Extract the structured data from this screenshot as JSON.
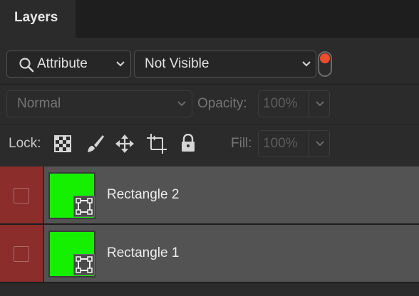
{
  "panel": {
    "tab_label": "Layers"
  },
  "filter": {
    "kind_label": "Attribute",
    "value_label": "Not Visible",
    "toggle_color": "#ea4e2c"
  },
  "blend": {
    "mode_label": "Normal",
    "opacity_label": "Opacity:",
    "opacity_value": "100%"
  },
  "lock": {
    "label": "Lock:",
    "icons": [
      "transparent-pixels-lock-icon",
      "brush-lock-icon",
      "move-lock-icon",
      "artboard-lock-icon",
      "padlock-icon"
    ],
    "fill_label": "Fill:",
    "fill_value": "100%"
  },
  "layers": [
    {
      "name": "Rectangle 2",
      "thumb_color": "#14f000",
      "visible": false
    },
    {
      "name": "Rectangle 1",
      "thumb_color": "#14f000",
      "visible": false
    }
  ]
}
